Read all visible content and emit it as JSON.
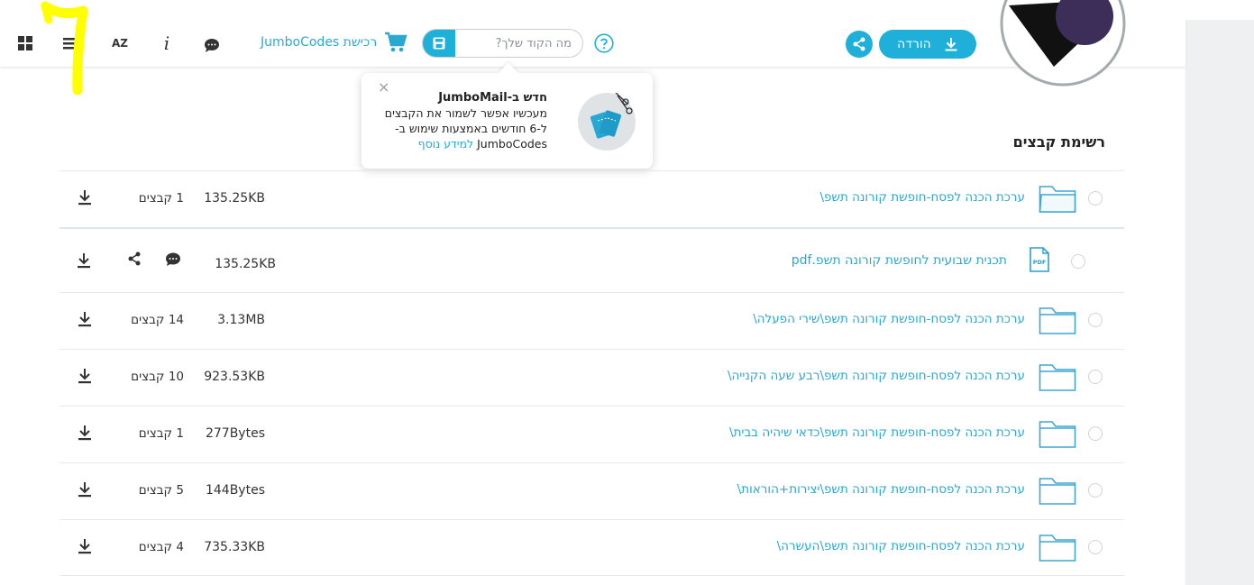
{
  "toolbar": {
    "cart_label": "רכישת JumboCodes",
    "code_placeholder": "מה הקוד שלך?",
    "download_label": "הורדה",
    "icons": [
      "grid-view-icon",
      "list-view-icon",
      "sort-az-icon",
      "info-icon",
      "comment-icon",
      "cart-icon",
      "save-icon",
      "help-icon",
      "share-icon",
      "download-icon"
    ],
    "sort_label": "AZ",
    "info_label": "i"
  },
  "popover": {
    "close": "×",
    "title": "חדש ב-JumboMail",
    "body": "מעכשיו אפשר לשמור את הקבצים ל-6 חודשים באמצעות שימוש ב-JumboCodes",
    "link": "למידע נוסף"
  },
  "files": {
    "title": "רשימת קבצים",
    "rows": [
      {
        "name": "ערכת הכנה לפסח-חופשת קורונה תשפ\\",
        "size": "135.25KB",
        "count": "1 קבצים"
      },
      {
        "name": "תכנית שבועית לחופשת קורונה תשפ.pdf",
        "size": "135.25KB",
        "badge": "PDF"
      },
      {
        "name": "ערכת הכנה לפסח-חופשת קורונה תשפ\\שירי הפעלה\\",
        "size": "3.13MB",
        "count": "14 קבצים"
      },
      {
        "name": "ערכת הכנה לפסח-חופשת קורונה תשפ\\רבע שעה הקנייה\\",
        "size": "923.53KB",
        "count": "10 קבצים"
      },
      {
        "name": "ערכת הכנה לפסח-חופשת קורונה תשפ\\כדאי שיהיה בבית\\",
        "size": "277Bytes",
        "count": "1 קבצים"
      },
      {
        "name": "ערכת הכנה לפסח-חופשת קורונה תשפ\\יצירות+הוראות\\",
        "size": "144Bytes",
        "count": "5 קבצים"
      },
      {
        "name": "ערכת הכנה לפסח-חופשת קורונה תשפ\\העשרה\\",
        "size": "735.33KB",
        "count": "4 קבצים"
      }
    ]
  },
  "colors": {
    "accent": "#1fb0da",
    "link": "#2aa9d0",
    "highlight": "#ffff00"
  }
}
